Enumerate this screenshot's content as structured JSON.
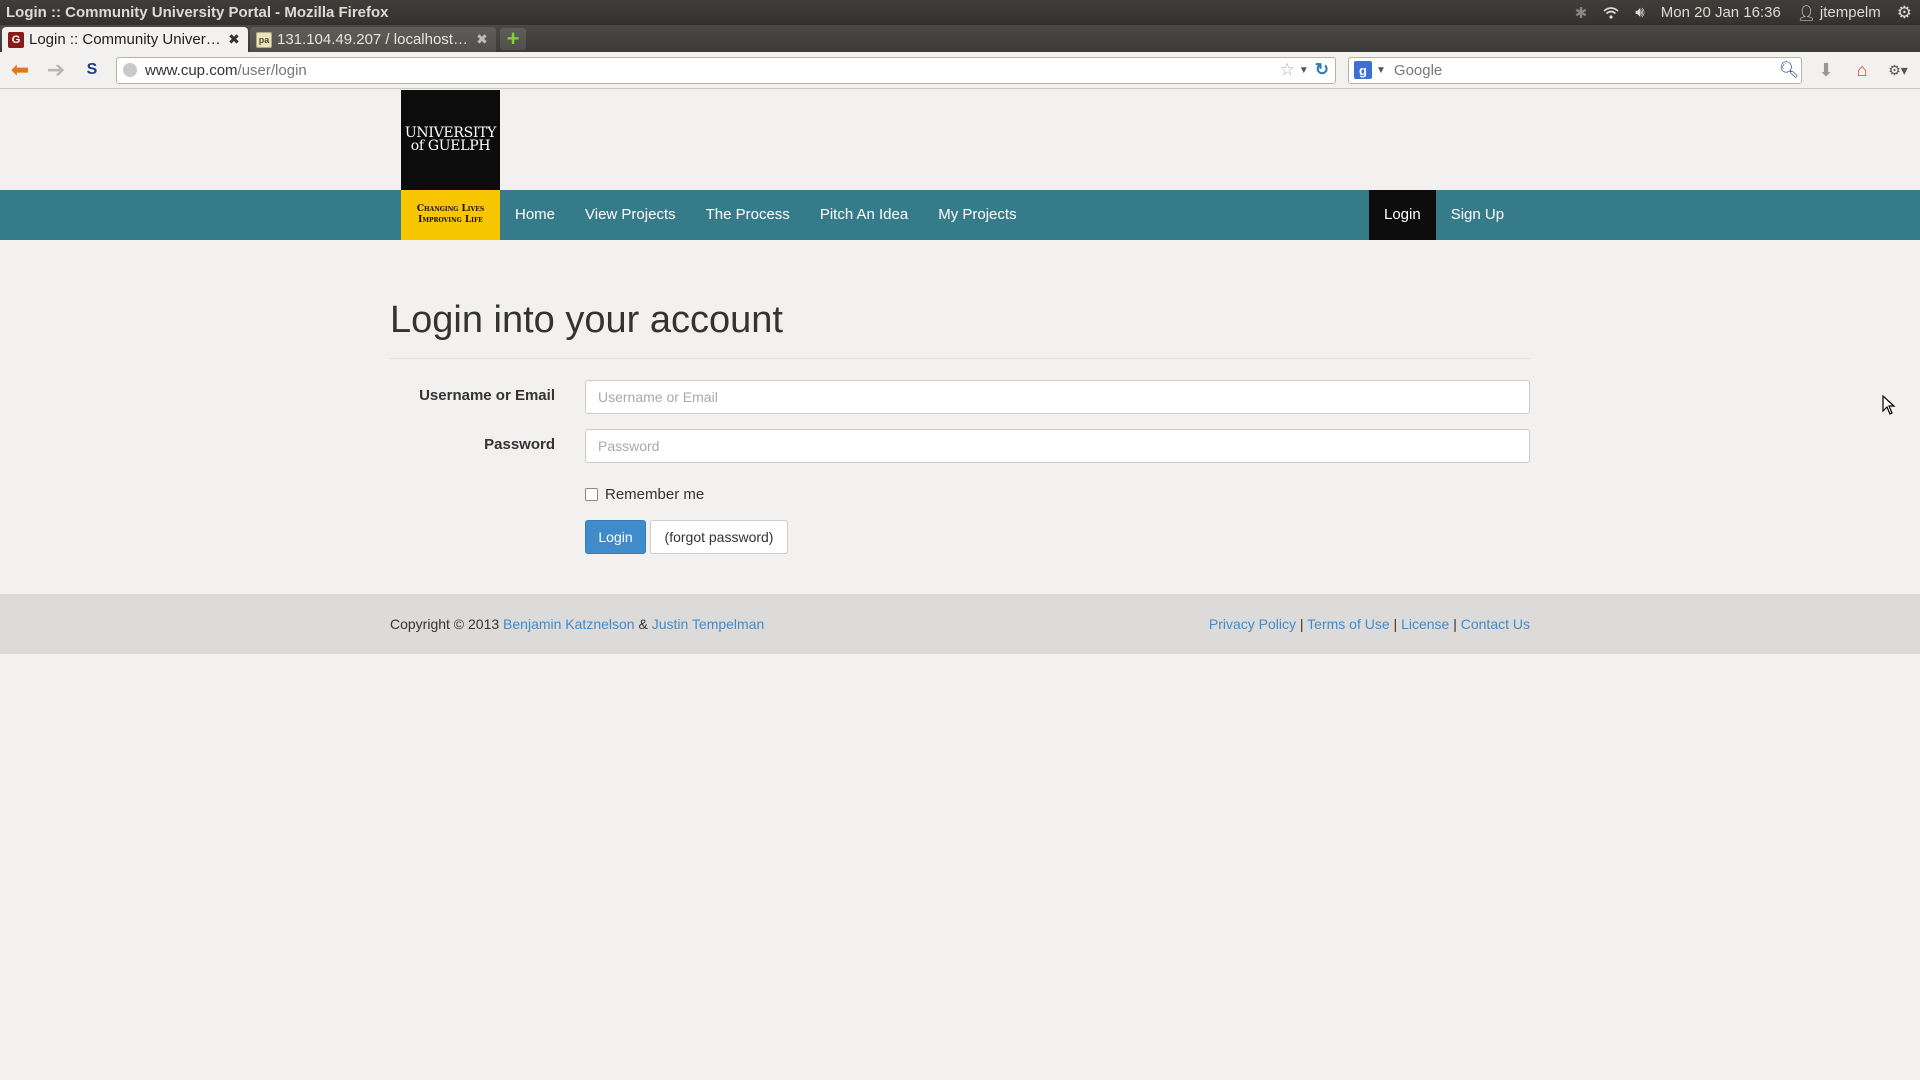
{
  "os": {
    "window_title": "Login :: Community University Portal - Mozilla Firefox",
    "clock": "Mon 20 Jan 16:36",
    "user": "jtempelm"
  },
  "browser": {
    "tabs": [
      {
        "label": "Login :: Community Universi...",
        "active": true
      },
      {
        "label": "131.104.49.207 / localhost / ...",
        "active": false
      }
    ],
    "url_host": "www.cup.com",
    "url_path": "/user/login",
    "search_placeholder": "Google"
  },
  "site": {
    "logo_text": "UNIVERSITY of GUELPH",
    "tagline_line1": "Changing Lives",
    "tagline_line2": "Improving Life",
    "nav": {
      "items": [
        {
          "label": "Home"
        },
        {
          "label": "View Projects"
        },
        {
          "label": "The Process"
        },
        {
          "label": "Pitch An Idea"
        },
        {
          "label": "My Projects"
        }
      ],
      "right_items": [
        {
          "label": "Login",
          "active": true
        },
        {
          "label": "Sign Up"
        }
      ]
    }
  },
  "main": {
    "heading": "Login into your account",
    "username_label": "Username or Email",
    "username_placeholder": "Username or Email",
    "username_value": "",
    "password_label": "Password",
    "password_placeholder": "Password",
    "password_value": "",
    "remember_label": "Remember me",
    "remember_checked": false,
    "login_button": "Login",
    "forgot_button": "(forgot password)"
  },
  "footer": {
    "copyright_prefix": "Copyright © 2013",
    "author1": "Benjamin Katznelson",
    "ampersand": "&",
    "author2": "Justin Tempelman",
    "links": [
      "Privacy Policy",
      "Terms of Use",
      "License",
      "Contact Us"
    ],
    "separator": "|"
  },
  "colors": {
    "navbar": "#367b8a",
    "tagline_bg": "#f7c600",
    "primary_button": "#428bca",
    "link": "#428bca"
  }
}
